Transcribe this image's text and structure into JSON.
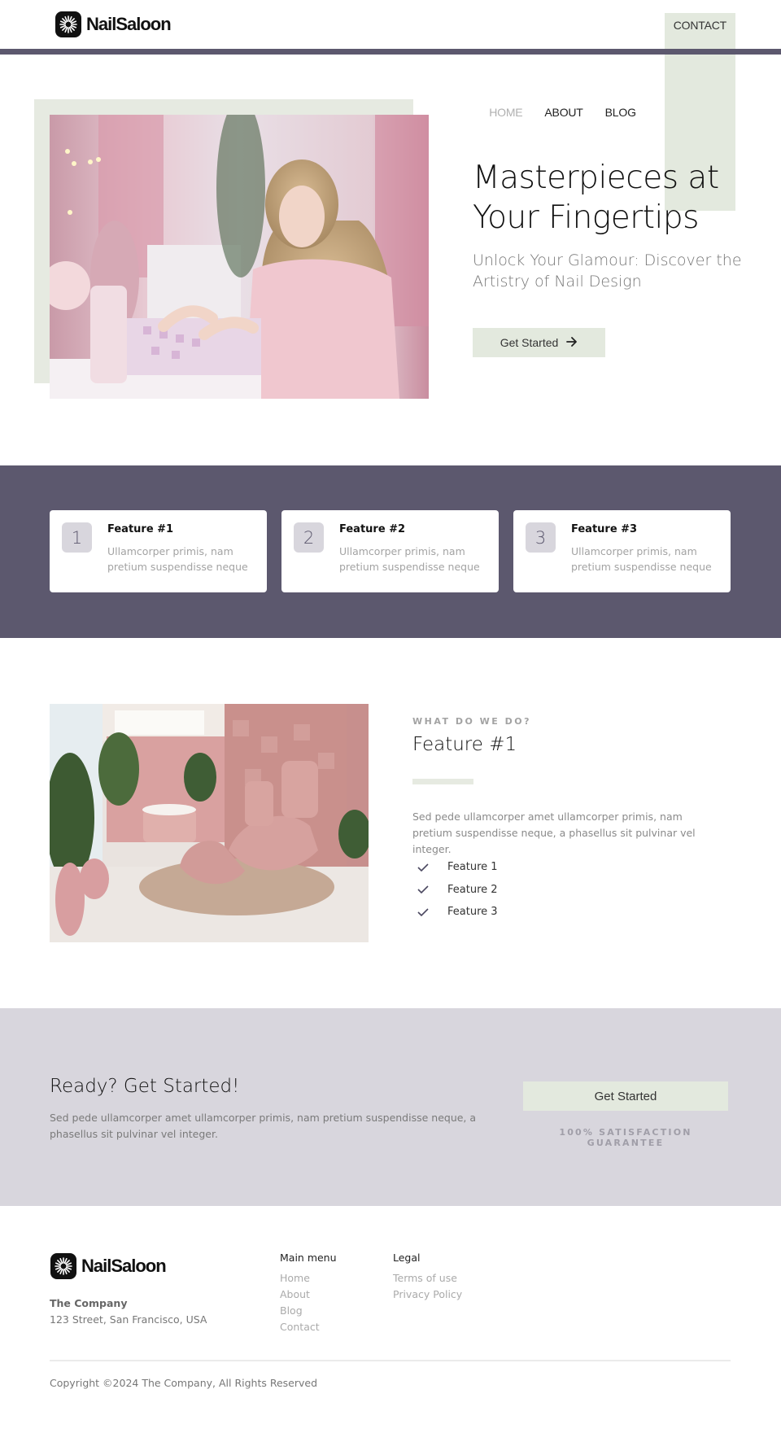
{
  "header": {
    "brand": "NailSaloon",
    "logo_icon": "sunburst-logo-icon",
    "nav": [
      {
        "label": "HOME",
        "active": true
      },
      {
        "label": "ABOUT",
        "active": false
      },
      {
        "label": "BLOG",
        "active": false
      },
      {
        "label": "CONTACT",
        "active": false,
        "highlighted": true
      }
    ]
  },
  "hero": {
    "title": "Masterpieces at Your Fingertips",
    "subtitle": "Unlock Your Glamour: Discover the Artistry of Nail Design",
    "button_label": "Get Started",
    "button_icon": "arrow-right-icon",
    "image_alt": "Woman in pink sweater selecting nail polish in a pink salon"
  },
  "features": [
    {
      "number": "1",
      "title": "Feature #1",
      "description": "Ullamcorper primis, nam pretium suspendisse neque"
    },
    {
      "number": "2",
      "title": "Feature #2",
      "description": "Ullamcorper primis, nam pretium suspendisse neque"
    },
    {
      "number": "3",
      "title": "Feature #3",
      "description": "Ullamcorper primis, nam pretium suspendisse neque"
    }
  ],
  "what_we_do": {
    "eyebrow": "WHAT DO WE DO?",
    "title": "Feature #1",
    "description": "Sed pede ullamcorper amet ullamcorper primis, nam pretium suspendisse neque, a phasellus sit pulvinar vel integer.",
    "list": [
      "Feature 1",
      "Feature 2",
      "Feature 3"
    ],
    "image_alt": "Pink spa room with pedicure chairs, plants and fur rug"
  },
  "cta": {
    "title": "Ready? Get Started!",
    "description": "Sed pede ullamcorper amet ullamcorper primis, nam pretium suspendisse neque, a phasellus sit pulvinar vel integer.",
    "button_label": "Get Started",
    "guarantee": "100% SATISFACTION GUARANTEE"
  },
  "footer": {
    "brand": "NailSaloon",
    "company": "The Company",
    "address": "123 Street, San Francisco, USA",
    "main_menu": {
      "heading": "Main menu",
      "links": [
        "Home",
        "About",
        "Blog",
        "Contact"
      ]
    },
    "legal": {
      "heading": "Legal",
      "links": [
        "Terms of use",
        "Privacy Policy"
      ]
    },
    "copyright": "Copyright ©2024 The Company, All Rights Reserved"
  },
  "colors": {
    "accent_dark": "#5c586e",
    "accent_light": "#e3e9de",
    "band_light": "#d8d6dd"
  }
}
